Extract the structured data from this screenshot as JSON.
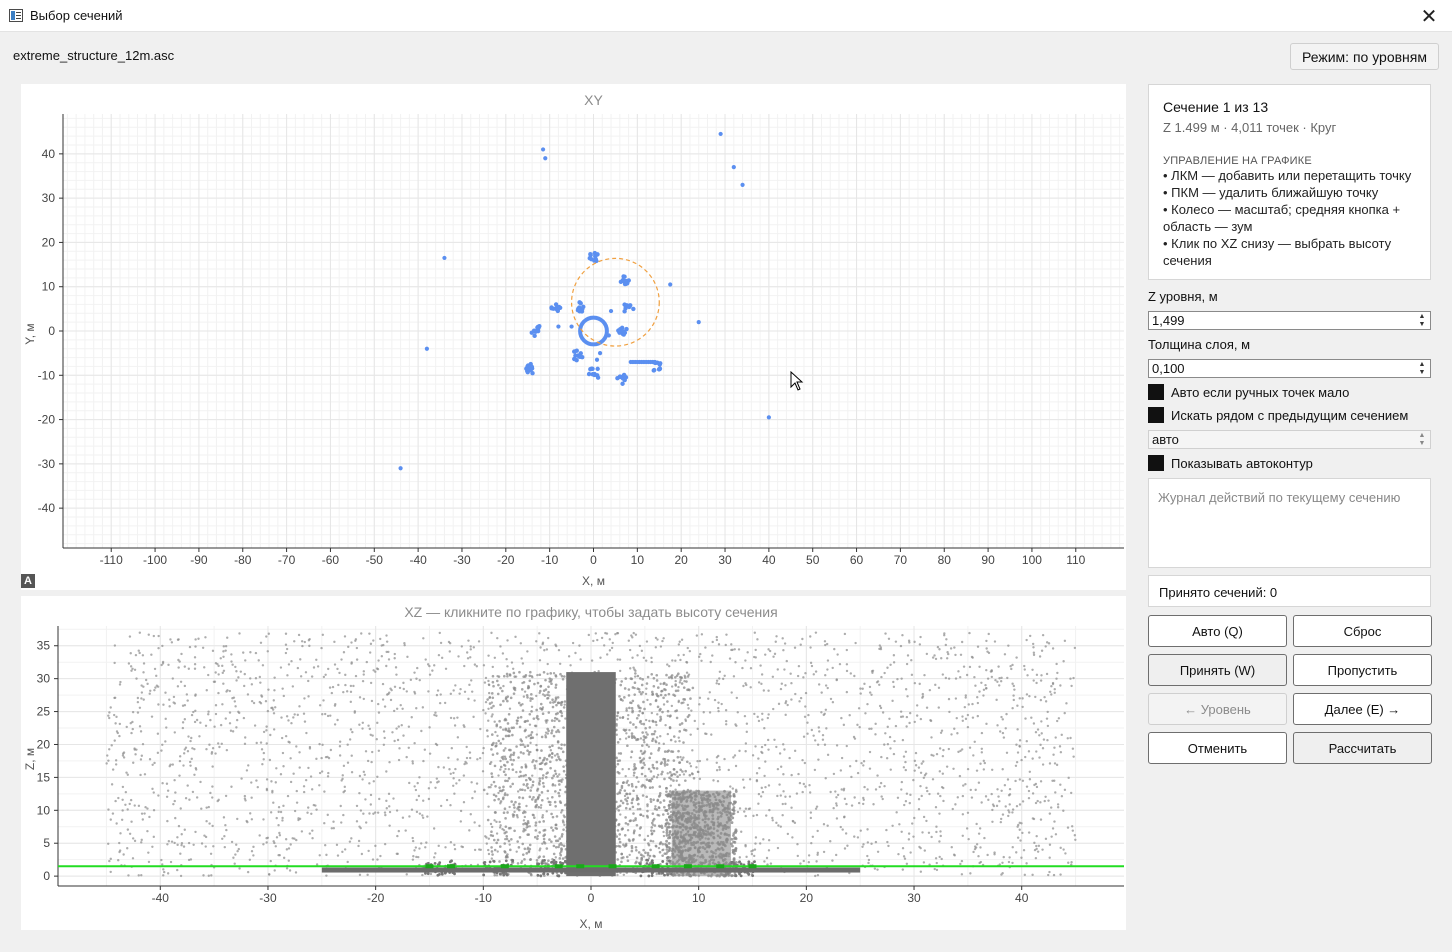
{
  "window": {
    "title": "Выбор сечений"
  },
  "file": {
    "name": "extreme_structure_12m.asc"
  },
  "mode_button": "Режим: по уровням",
  "xy_chart_data": {
    "type": "scatter",
    "title": "XY",
    "xlabel": "X, м",
    "ylabel": "Y, м",
    "xlim": [
      -121,
      121
    ],
    "ylim": [
      -49,
      49
    ],
    "xticks": [
      -110,
      -100,
      -90,
      -80,
      -70,
      -60,
      -50,
      -40,
      -30,
      -20,
      -10,
      0,
      10,
      20,
      30,
      40,
      50,
      60,
      70,
      80,
      90,
      100,
      110
    ],
    "yticks": [
      -40,
      -30,
      -20,
      -10,
      0,
      10,
      20,
      30,
      40
    ],
    "point_color": "#5b8ff0",
    "clusters": [
      {
        "x": 0,
        "y": 16.5,
        "n": 14
      },
      {
        "x": 7,
        "y": 11.5,
        "n": 12
      },
      {
        "x": -3,
        "y": 5.5,
        "n": 10
      },
      {
        "x": -8.5,
        "y": 5,
        "n": 10
      },
      {
        "x": 8,
        "y": 5,
        "n": 10
      },
      {
        "x": -13,
        "y": 0,
        "n": 10
      },
      {
        "x": 6.5,
        "y": 0,
        "n": 10
      },
      {
        "x": -3.5,
        "y": -5.5,
        "n": 12
      },
      {
        "x": -14.5,
        "y": -8.5,
        "n": 14
      },
      {
        "x": 0,
        "y": -9.5,
        "n": 10
      },
      {
        "x": 6.5,
        "y": -11,
        "n": 10
      },
      {
        "x": 14.5,
        "y": -8,
        "n": 10
      }
    ],
    "scattered_points": [
      {
        "x": -11.5,
        "y": 41
      },
      {
        "x": -11,
        "y": 39
      },
      {
        "x": 29,
        "y": 44.5
      },
      {
        "x": 32,
        "y": 37
      },
      {
        "x": 34,
        "y": 33
      },
      {
        "x": -34,
        "y": 16.5
      },
      {
        "x": 17.5,
        "y": 10.5
      },
      {
        "x": 24,
        "y": 2
      },
      {
        "x": -38,
        "y": -4
      },
      {
        "x": 40,
        "y": -19.5
      },
      {
        "x": -44,
        "y": -31
      },
      {
        "x": 4,
        "y": 4.5
      },
      {
        "x": -5,
        "y": 1
      },
      {
        "x": 3.5,
        "y": -1
      },
      {
        "x": 1.5,
        "y": -5
      },
      {
        "x": 0.8,
        "y": -6.5
      },
      {
        "x": -8,
        "y": 1
      }
    ],
    "line_points": {
      "x_from": 8.5,
      "x_to": 14,
      "y": -7,
      "n": 12
    },
    "ring": {
      "cx": 0,
      "cy": 0,
      "r": 1.8,
      "color": "#5b8ff0"
    },
    "circle": {
      "cx": 5,
      "cy": 6.5,
      "r": 10,
      "color": "#f0a040",
      "dashed": true
    }
  },
  "xz_chart_data": {
    "type": "scatter",
    "title": "XZ — кликните по графику, чтобы задать высоту сечения",
    "xlabel": "X, м",
    "ylabel": "Z, м",
    "xlim": [
      -49.5,
      49.5
    ],
    "ylim": [
      -1.5,
      38
    ],
    "xticks": [
      -40,
      -30,
      -20,
      -10,
      0,
      10,
      20,
      30,
      40
    ],
    "yticks": [
      0,
      5,
      10,
      15,
      20,
      25,
      30,
      35
    ],
    "point_color": "#8a8a8a",
    "column": {
      "x0": -2.3,
      "x1": 2.3,
      "z0": 0,
      "z1": 31
    },
    "block": {
      "x0": 7.5,
      "x1": 13,
      "z0": 0,
      "z1": 13
    },
    "ground": {
      "x0": -25,
      "x1": 25,
      "z": 1
    },
    "section_line": {
      "z": 1.499,
      "color": "#22dd22"
    }
  },
  "panel": {
    "section_title": "Сечение 1 из 13",
    "section_sub": "Z 1.499 м · 4,011 точек · Круг",
    "help_head": "УПРАВЛЕНИЕ НА ГРАФИКЕ",
    "help_1": "• ЛКМ — добавить или перетащить точку",
    "help_2": "• ПКМ — удалить ближайшую точку",
    "help_3": "• Колесо — масштаб; средняя кнопка + область — зум",
    "help_4": "• Клик по XZ снизу — выбрать высоту сечения",
    "z_label": "Z уровня, м",
    "z_value": "1,499",
    "thickness_label": "Толщина слоя, м",
    "thickness_value": "0,100",
    "cb_auto": "Авто если ручных точек мало",
    "cb_near": "Искать рядом с предыдущим сечением",
    "combo_value": "авто",
    "cb_contour": "Показывать автоконтур",
    "log_placeholder": "Журнал действий по текущему сечению",
    "accepted": "Принято сечений: 0"
  },
  "buttons": {
    "auto": "Авто (Q)",
    "reset": "Сброс",
    "accept": "Принять (W)",
    "skip": "Пропустить",
    "prev_level": "← Уровень",
    "next": "Далее (E) →",
    "cancel": "Отменить",
    "calculate": "Рассчитать"
  },
  "icons": {
    "app": "app-window-icon",
    "close": "close-icon",
    "autoscale": "autoscale-a-icon",
    "cursor": "mouse-pointer-icon"
  }
}
